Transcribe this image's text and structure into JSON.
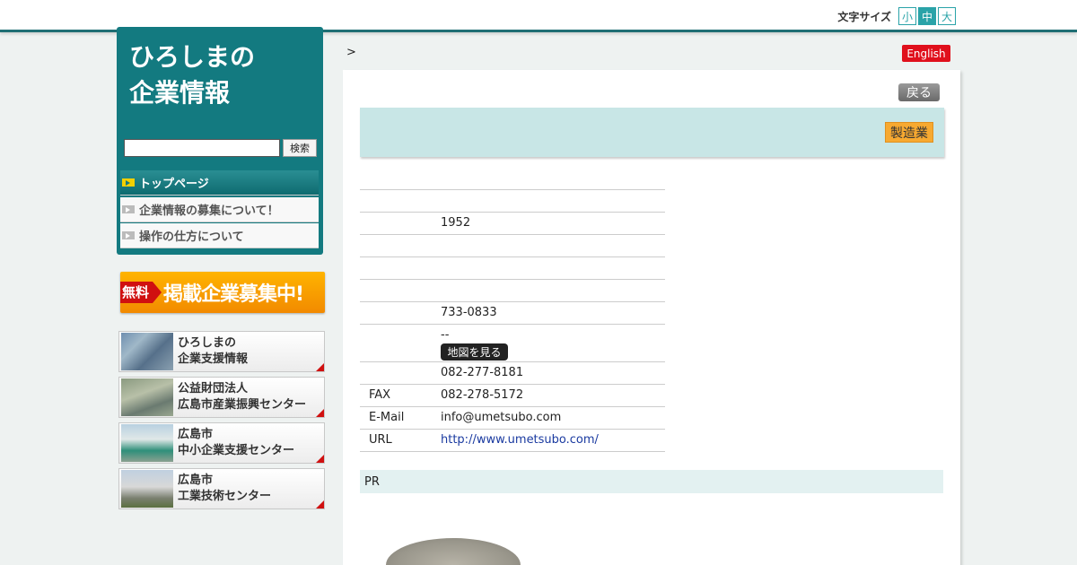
{
  "header": {
    "font_size_label": "文字サイズ",
    "font_size_options": [
      "小",
      "中",
      "大"
    ],
    "font_size_selected": "中"
  },
  "sidebar": {
    "site_title_line1": "ひろしまの",
    "site_title_line2": "企業情報",
    "search_placeholder": "",
    "search_button": "検索",
    "nav_items": [
      "トップページ",
      "企業情報の募集について！",
      "操作の仕方について"
    ]
  },
  "banners": {
    "recruit_free_tag": "無料",
    "recruit_text": "掲載企業募集中!",
    "links": [
      {
        "line1": "ひろしまの",
        "line2": "企業支援情報"
      },
      {
        "line1": "公益財団法人",
        "line2": "広島市産業振興センター"
      },
      {
        "line1": "広島市",
        "line2": "中小企業支援センター"
      },
      {
        "line1": "広島市",
        "line2": "工業技術センター"
      }
    ]
  },
  "main": {
    "breadcrumb_separator": ">",
    "english_button": "English",
    "back_button": "戻る",
    "industry_badge": "製造業",
    "info_rows": [
      {
        "label": "",
        "value": ""
      },
      {
        "label": "",
        "value": ""
      },
      {
        "label": "",
        "value": "1952"
      },
      {
        "label": "",
        "value": ""
      },
      {
        "label": "",
        "value": ""
      },
      {
        "label": "",
        "value": ""
      },
      {
        "label": "",
        "value": "733-0833"
      }
    ],
    "address_value": "--",
    "map_button": "地図を見る",
    "phone": "082-277-8181",
    "fax_label": "FAX",
    "fax": "082-278-5172",
    "email_label": "E-Mail",
    "email": "info@umetsubo.com",
    "url_label": "URL",
    "url": "http://www.umetsubo.com/",
    "pr_label": "PR"
  },
  "colors": {
    "brand_teal": "#137a80",
    "english_red": "#e0101c",
    "industry_orange": "#f7a930",
    "header_band": "#c8e6e6"
  }
}
